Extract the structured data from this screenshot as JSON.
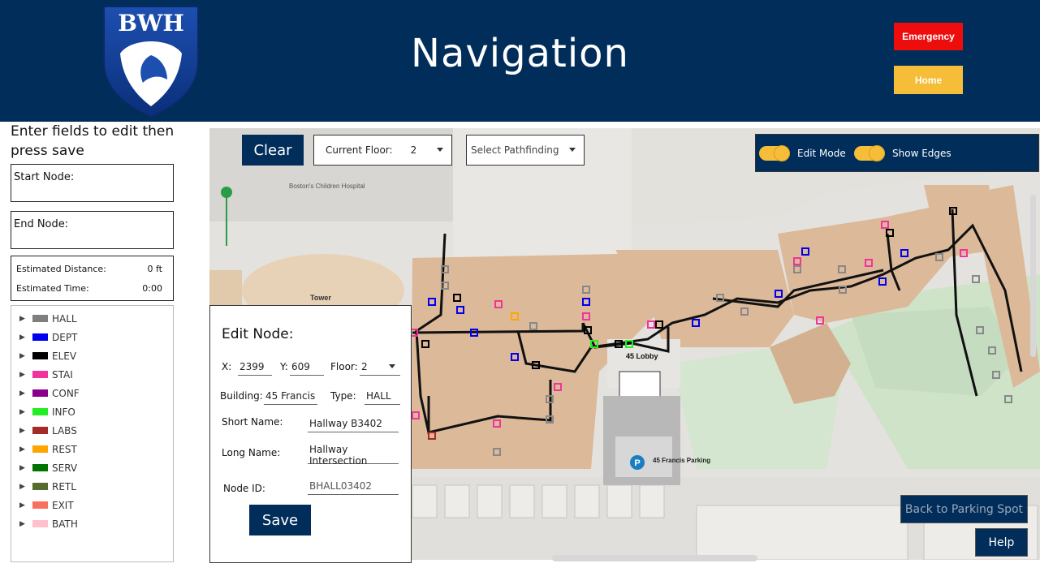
{
  "header": {
    "logo_text": "BWH",
    "title": "Navigation",
    "emergency_label": "Emergency",
    "home_label": "Home"
  },
  "sidebar": {
    "instructions": "Enter fields to edit then press save",
    "start_node_label": "Start Node:",
    "end_node_label": "End Node:",
    "estimated_distance_label": "Estimated Distance:",
    "estimated_distance_value": "0 ft",
    "estimated_time_label": "Estimated Time:",
    "estimated_time_value": "0:00",
    "legend": [
      {
        "label": "HALL",
        "color": "#7f7f7f"
      },
      {
        "label": "DEPT",
        "color": "#0000ee"
      },
      {
        "label": "ELEV",
        "color": "#000000"
      },
      {
        "label": "STAI",
        "color": "#f0349b"
      },
      {
        "label": "CONF",
        "color": "#8b008b"
      },
      {
        "label": "INFO",
        "color": "#22ee22"
      },
      {
        "label": "LABS",
        "color": "#a52a2a"
      },
      {
        "label": "REST",
        "color": "#ffa500"
      },
      {
        "label": "SERV",
        "color": "#007400"
      },
      {
        "label": "RETL",
        "color": "#556b2f"
      },
      {
        "label": "EXIT",
        "color": "#fa7060"
      },
      {
        "label": "BATH",
        "color": "#ffc0cb"
      }
    ]
  },
  "toolbar": {
    "clear_label": "Clear",
    "current_floor_label": "Current Floor:",
    "current_floor_value": "2",
    "pathfinding_placeholder": "Select Pathfinding",
    "edit_mode_label": "Edit Mode",
    "show_edges_label": "Show Edges"
  },
  "map": {
    "labels": {
      "boston_childrens": "Boston's Children Hospital",
      "tower": "Tower",
      "lobby": "45 Lobby",
      "parking": "45 Francis Parking",
      "parking_symbol": "P"
    }
  },
  "edit_node": {
    "title": "Edit Node:",
    "x_label": "X:",
    "x_value": "2399",
    "y_label": "Y:",
    "y_value": "609",
    "floor_label": "Floor:",
    "floor_value": "2",
    "building_label": "Building:",
    "building_value": "45 Francis",
    "type_label": "Type:",
    "type_value": "HALL",
    "short_name_label": "Short Name:",
    "short_name_value": "Hallway B3402",
    "long_name_label": "Long Name:",
    "long_name_value": "Hallway Intersection",
    "node_id_label": "Node ID:",
    "node_id_value": "BHALL03402",
    "save_label": "Save"
  },
  "footer": {
    "back_to_parking_label": "Back to Parking Spot",
    "help_label": "Help"
  }
}
